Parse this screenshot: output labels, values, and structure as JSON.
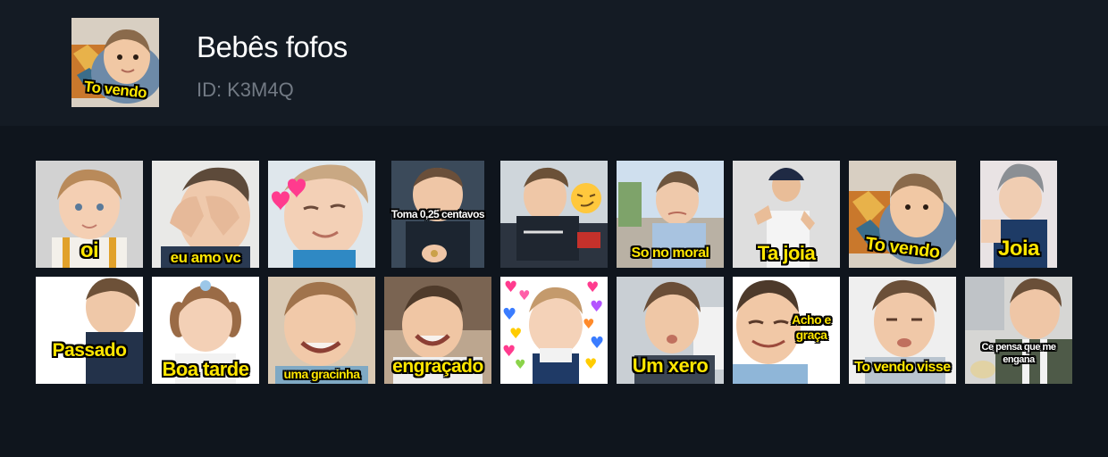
{
  "pack": {
    "title": "Bebês fofos",
    "id_label": "ID:",
    "id_value": "K3M4Q",
    "thumbnail_caption": "To vendo"
  },
  "stickers": [
    {
      "caption": "oi"
    },
    {
      "caption": "eu amo vc"
    },
    {
      "caption": ""
    },
    {
      "caption": "Toma 0,25 centavos"
    },
    {
      "caption": ""
    },
    {
      "caption": "So no moral"
    },
    {
      "caption": "Ta joia"
    },
    {
      "caption": "To vendo"
    },
    {
      "caption": "Joia"
    },
    {
      "caption": "Passado"
    },
    {
      "caption": "Boa tarde"
    },
    {
      "caption": "uma gracinha"
    },
    {
      "caption": "engraçado"
    },
    {
      "caption": ""
    },
    {
      "caption": "Um xero"
    },
    {
      "caption": "Acho e graça"
    },
    {
      "caption": "To vendo visse"
    },
    {
      "caption": "Ce pensa que me engana"
    }
  ],
  "colors": {
    "background": "#0f151d",
    "header": "#141b24",
    "title": "#ffffff",
    "id_text": "#727a84",
    "caption_yellow": "#ffe600"
  }
}
